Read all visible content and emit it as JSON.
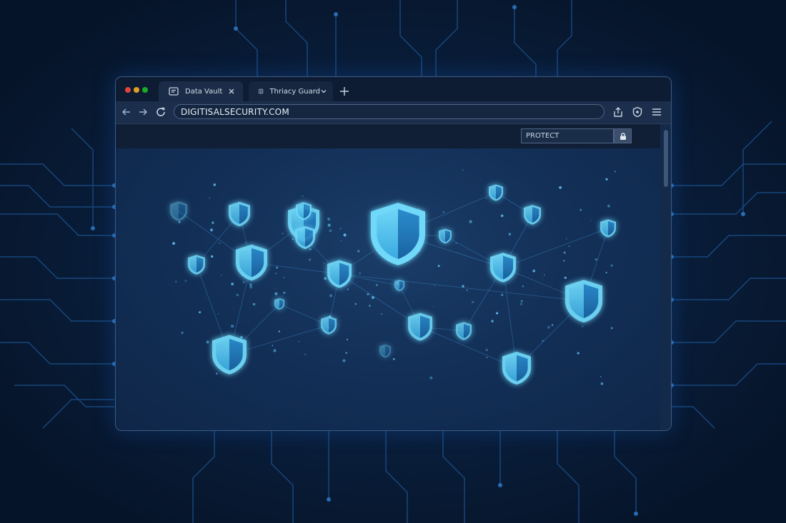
{
  "browser": {
    "tabs": [
      {
        "label": "Data Vault",
        "icon": "document-icon",
        "action_icon": "close-icon"
      },
      {
        "label": "Thriacy Guard",
        "icon": "document-icon",
        "action_icon": "chevron-down-icon"
      }
    ],
    "new_tab_icon": "plus-icon",
    "url": "DIGITISALSECURITY.COM",
    "toolbar_icons": [
      "back-arrow-icon",
      "forward-arrow-icon",
      "refresh-icon",
      "share-icon",
      "shield-icon",
      "menu-icon"
    ]
  },
  "page": {
    "protect_field": "PROTECT",
    "protect_button_icon": "lock-icon",
    "illustration": "shield-network"
  },
  "colors": {
    "background": "#071a33",
    "shield_light": "#5ed0f5",
    "shield_dark": "#1f7fbf",
    "accent": "#2ab4ee"
  }
}
